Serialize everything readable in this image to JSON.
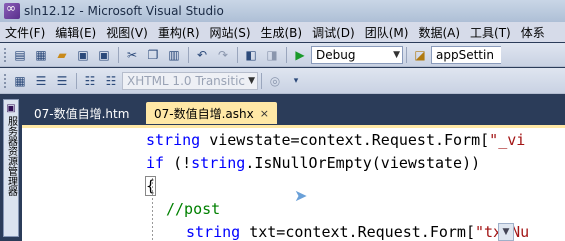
{
  "window": {
    "title": "sln12.12 - Microsoft Visual Studio"
  },
  "menu": {
    "items": [
      "文件(F)",
      "编辑(E)",
      "视图(V)",
      "重构(R)",
      "网站(S)",
      "生成(B)",
      "调试(D)",
      "团队(M)",
      "数据(A)",
      "工具(T)",
      "体系"
    ]
  },
  "toolbar": {
    "config_value": "Debug",
    "config_icon": "dropdown-arrow",
    "search_value": "appSettin",
    "doctype_value": "XHTML 1.0 Transitic"
  },
  "sidebar": {
    "label": "服务器资源管理器"
  },
  "tabs": [
    {
      "label": "07-数值自增.htm",
      "active": false
    },
    {
      "label": "07-数值自增.ashx",
      "active": true,
      "close": "×"
    }
  ],
  "code": {
    "line1_a": "string",
    "line1_b": " viewstate=context.Request.Form[",
    "line1_c": "\"_vi",
    "line2_a": "if",
    "line2_b": " (!",
    "line2_c": "string",
    "line2_d": ".IsNullOrEmpty(viewstate))",
    "line3": "{",
    "line4": "//post",
    "line5_a": "string",
    "line5_b": " txt=context.Request.Form[",
    "line5_c": "\"txtNu"
  },
  "colors": {
    "keyword": "#0000ff",
    "string": "#a31515",
    "comment": "#008000",
    "active_tab": "#ffe8a6",
    "chrome_background": "#2b3c59"
  }
}
